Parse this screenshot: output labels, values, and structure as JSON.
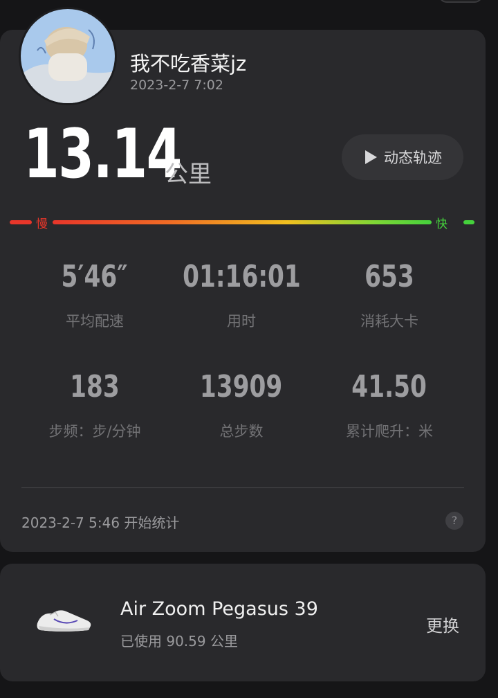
{
  "profile": {
    "username": "我不吃香菜jz",
    "post_time": "2023-2-7 7:02"
  },
  "run": {
    "distance": "13.14",
    "distance_unit": "公里",
    "track_button": "动态轨迹",
    "pace_slow_label": "慢",
    "pace_fast_label": "快"
  },
  "stats": [
    {
      "value": "5′46″",
      "label": "平均配速"
    },
    {
      "value": "01:16:01",
      "label": "用时"
    },
    {
      "value": "653",
      "label": "消耗大卡"
    },
    {
      "value": "183",
      "label": "步频：步/分钟"
    },
    {
      "value": "13909",
      "label": "总步数"
    },
    {
      "value": "41.50",
      "label": "累计爬升：米"
    }
  ],
  "footer": {
    "start_time": "2023-2-7 5:46 开始统计",
    "help": "?"
  },
  "shoe": {
    "name": "Air Zoom Pegasus 39",
    "usage": "已使用 90.59 公里",
    "change_button": "更换"
  },
  "colors": {
    "slow": "#e8362a",
    "fast": "#45d13c",
    "card": "#29292c",
    "background": "#151517"
  },
  "icons": [
    "avatar-image",
    "play-icon",
    "help-icon",
    "shoe-image"
  ]
}
